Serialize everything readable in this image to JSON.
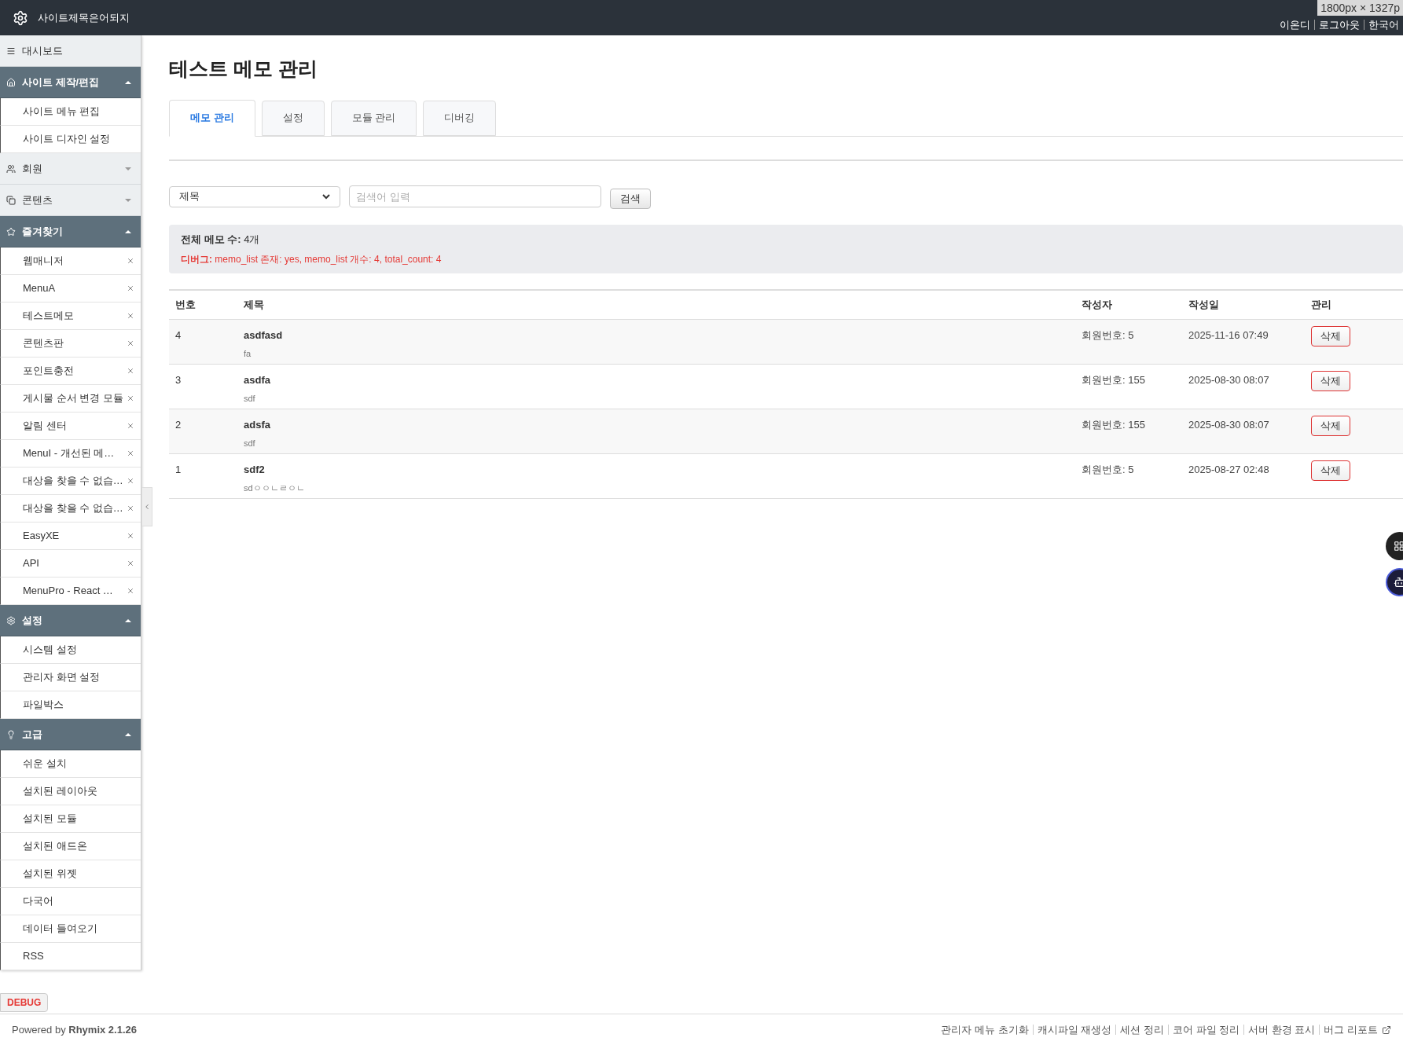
{
  "header": {
    "site_title": "사이트제목은어되지",
    "user_links": [
      "이온디",
      "로그아웃",
      "한국어"
    ],
    "size_overlay": "1800px × 1327p"
  },
  "sidebar": {
    "dashboard": "대시보드",
    "groups": [
      {
        "label": "사이트 제작/편집",
        "expanded": true,
        "items": [
          {
            "label": "사이트 메뉴 편집",
            "kind": "link"
          },
          {
            "label": "사이트 디자인 설정",
            "kind": "link"
          }
        ]
      },
      {
        "label": "회원",
        "expanded": false
      },
      {
        "label": "콘텐츠",
        "expanded": false
      },
      {
        "label": "즐겨찾기",
        "expanded": true,
        "items": [
          {
            "label": "웹매니저",
            "kind": "favorite"
          },
          {
            "label": "MenuA",
            "kind": "favorite"
          },
          {
            "label": "테스트메모",
            "kind": "favorite"
          },
          {
            "label": "콘텐츠판",
            "kind": "favorite"
          },
          {
            "label": "포인트충전",
            "kind": "favorite"
          },
          {
            "label": "게시물 순서 변경 모듈",
            "kind": "favorite"
          },
          {
            "label": "알림 센터",
            "kind": "favorite"
          },
          {
            "label": "MenuI - 개선된 메…",
            "kind": "favorite"
          },
          {
            "label": "대상을 찾을 수 없습…",
            "kind": "favorite"
          },
          {
            "label": "대상을 찾을 수 없습…",
            "kind": "favorite"
          },
          {
            "label": "EasyXE",
            "kind": "favorite"
          },
          {
            "label": "API",
            "kind": "favorite"
          },
          {
            "label": "MenuPro - React …",
            "kind": "favorite"
          }
        ]
      },
      {
        "label": "설정",
        "expanded": true,
        "items": [
          {
            "label": "시스템 설정",
            "kind": "link"
          },
          {
            "label": "관리자 화면 설정",
            "kind": "link"
          },
          {
            "label": "파일박스",
            "kind": "link"
          }
        ]
      },
      {
        "label": "고급",
        "expanded": true,
        "items": [
          {
            "label": "쉬운 설치",
            "kind": "link"
          },
          {
            "label": "설치된 레이아웃",
            "kind": "link"
          },
          {
            "label": "설치된 모듈",
            "kind": "link"
          },
          {
            "label": "설치된 애드온",
            "kind": "link"
          },
          {
            "label": "설치된 위젯",
            "kind": "link"
          },
          {
            "label": "다국어",
            "kind": "link"
          },
          {
            "label": "데이터 들여오기",
            "kind": "link"
          },
          {
            "label": "RSS",
            "kind": "link"
          }
        ]
      }
    ]
  },
  "page_title": "테스트 메모 관리",
  "tabs": [
    {
      "label": "메모 관리",
      "selected": true
    },
    {
      "label": "설정",
      "selected": false
    },
    {
      "label": "모듈 관리",
      "selected": false
    },
    {
      "label": "디버깅",
      "selected": false
    }
  ],
  "search": {
    "field": "제목",
    "placeholder": "검색어 입력",
    "button": "검색"
  },
  "summary": {
    "total": "**전체 메모 수:** 4개",
    "debug": "**디버그:** memo_list 존재: yes, memo_list 개수: 4, total_count: 4"
  },
  "table": {
    "columns": [
      "번호",
      "제목",
      "작성자",
      "작성일",
      "관리"
    ],
    "rows": [
      {
        "no": "4",
        "title": "asdfasd",
        "content": "fa",
        "author": "회원번호: 5",
        "date": "2025-11-16 07:49",
        "action": "삭제"
      },
      {
        "no": "3",
        "title": "asdfa",
        "content": "sdf",
        "author": "회원번호: 155",
        "date": "2025-08-30 08:07",
        "action": "삭제"
      },
      {
        "no": "2",
        "title": "adsfa",
        "content": "sdf",
        "author": "회원번호: 155",
        "date": "2025-08-30 08:07",
        "action": "삭제"
      },
      {
        "no": "1",
        "title": "sdf2",
        "content": "sdㅇㅇㄴㄹㅇㄴ",
        "author": "회원번호: 5",
        "date": "2025-08-27 02:48",
        "action": "삭제"
      }
    ]
  },
  "footer": {
    "debug_badge": "DEBUG",
    "powered": "Powered by **Rhymix 2.1.26**",
    "links": [
      "관리자 메뉴 초기화",
      "캐시파일 재생성",
      "세션 정리",
      "코어 파일 정리",
      "서버 환경 표시",
      "버그 리포트"
    ]
  }
}
